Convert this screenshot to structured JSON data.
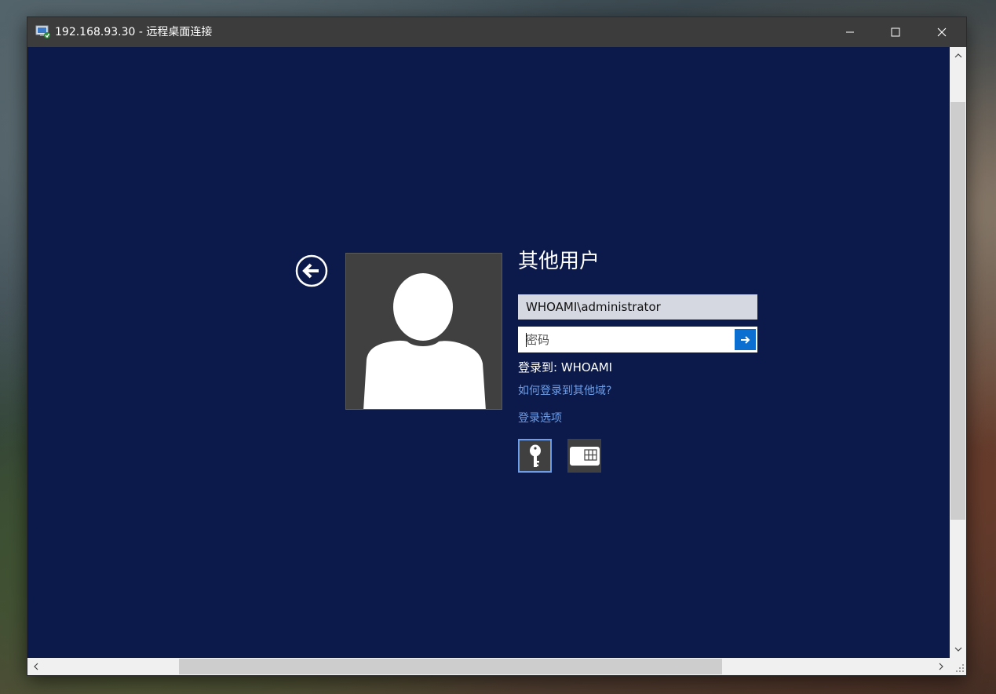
{
  "window": {
    "title": "192.168.93.30 - 远程桌面连接",
    "app_icon": "remote-desktop-icon",
    "controls": [
      "minimize-icon",
      "maximize-icon",
      "close-icon"
    ]
  },
  "login": {
    "back_icon": "back-arrow-icon",
    "avatar_icon": "user-silhouette-icon",
    "user_title": "其他用户",
    "username_value": "WHOAMI\\administrator",
    "password_placeholder": "密码",
    "submit_icon": "arrow-right-icon",
    "domain_label": "登录到: WHOAMI",
    "other_domain_link": "如何登录到其他域?",
    "options_link": "登录选项",
    "options": [
      {
        "icon": "key-icon",
        "selected": true
      },
      {
        "icon": "smart-card-icon",
        "selected": false
      }
    ]
  },
  "colors": {
    "background": "#0b1a4a",
    "accent": "#0a6fd0",
    "link": "#6f9ee8",
    "titlebar": "#3c3c3c"
  }
}
